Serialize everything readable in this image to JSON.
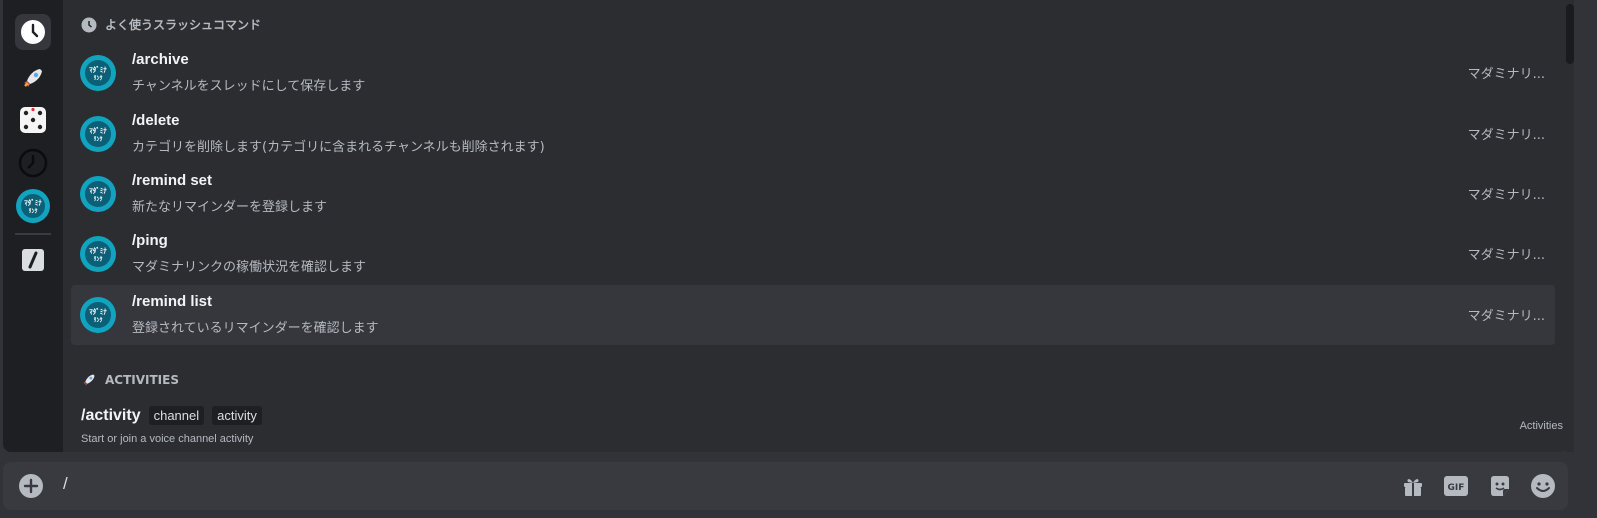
{
  "frequent": {
    "header": "よく使うスラッシュコマンド",
    "header_icon": "clock-icon",
    "commands": [
      {
        "name": "/archive",
        "description": "チャンネルをスレッドにして保存します",
        "source": "マダミナリ..."
      },
      {
        "name": "/delete",
        "description": "カテゴリを削除します(カテゴリに含まれるチャンネルも削除されます)",
        "source": "マダミナリ..."
      },
      {
        "name": "/remind set",
        "description": "新たなリマインダーを登録します",
        "source": "マダミナリ..."
      },
      {
        "name": "/ping",
        "description": "マダミナリンクの稼働状況を確認します",
        "source": "マダミナリ..."
      },
      {
        "name": "/remind list",
        "description": "登録されているリマインダーを確認します",
        "source": "マダミナリ..."
      }
    ],
    "avatar_text": "マダミナ リンク"
  },
  "activities": {
    "header": "ACTIVITIES",
    "header_icon": "rocket-icon",
    "command": {
      "name": "/activity",
      "options": [
        "channel",
        "activity"
      ],
      "description": "Start or join a voice channel activity",
      "source": "Activities"
    }
  },
  "rail": {
    "items": [
      "clock-icon",
      "rocket-icon",
      "dice-icon",
      "clock-outline-icon",
      "app-avatar",
      "slash-icon"
    ]
  },
  "input": {
    "value": "/",
    "tools": [
      "gift-icon",
      "gif-icon",
      "sticker-icon",
      "emoji-icon"
    ]
  },
  "colors": {
    "background": "#313338",
    "panel": "#2b2d31",
    "rail": "#1e1f22",
    "hover": "#35373c",
    "avatar": "#0e7c95"
  }
}
